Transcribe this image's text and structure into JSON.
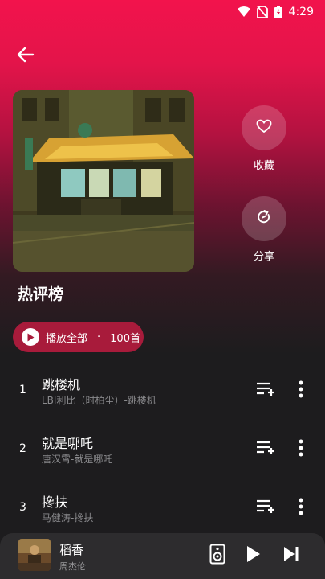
{
  "status_bar": {
    "time": "4:29"
  },
  "header": {
    "back_icon": "arrow-left-icon"
  },
  "playlist": {
    "title": "热评榜",
    "actions": [
      {
        "label": "收藏",
        "icon": "heart-icon"
      },
      {
        "label": "分享",
        "icon": "share-icon"
      }
    ],
    "play_all": {
      "label": "播放全部",
      "separator": "·",
      "count": "100首"
    }
  },
  "songs": [
    {
      "index": "1",
      "title": "跳楼机",
      "subtitle": "LBI利比（时柏尘）-跳楼机"
    },
    {
      "index": "2",
      "title": "就是哪吒",
      "subtitle": "唐汉霄-就是哪吒"
    },
    {
      "index": "3",
      "title": "搀扶",
      "subtitle": "马健涛-搀扶"
    }
  ],
  "now_playing": {
    "title": "稻香",
    "artist": "周杰伦"
  },
  "colors": {
    "accent": "#f2134c",
    "play_all_bg": "#a81b3b",
    "background": "#1d1c1e",
    "mini_player_bg": "#2d2c2e"
  }
}
